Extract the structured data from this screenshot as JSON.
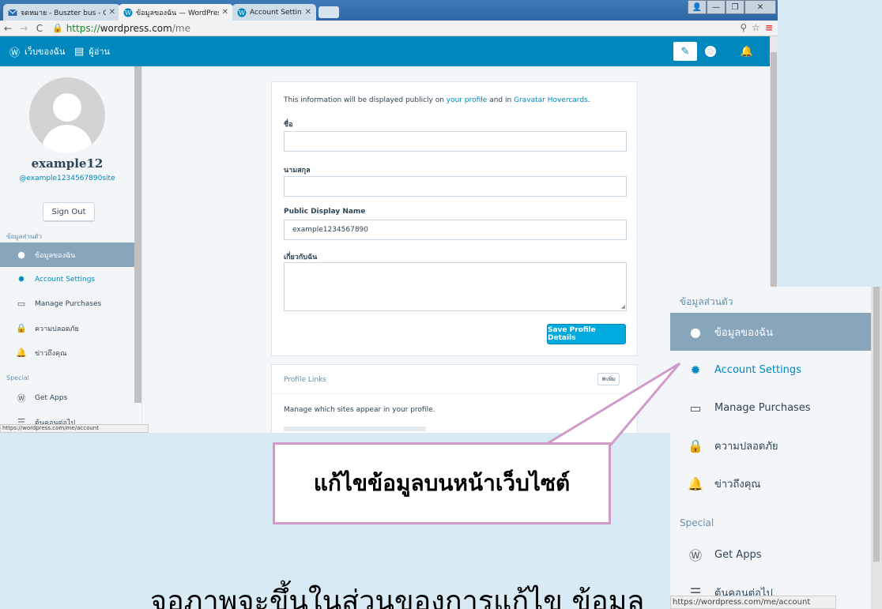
{
  "browser": {
    "tabs": [
      {
        "title": "จดหมาย - Buszter bus - Outlo",
        "icon": "mail-icon"
      },
      {
        "title": "ข้อมูลของฉัน — WordPress.c",
        "icon": "wordpress-icon"
      },
      {
        "title": "Account Settings — WordPre",
        "icon": "wordpress-icon"
      }
    ],
    "url": {
      "scheme": "https://",
      "host": "wordpress.com",
      "path": "/me"
    },
    "status_url": "https://wordpress.com/me/account"
  },
  "masterbar": {
    "my_sites": "เว็บของฉัน",
    "reader": "ผู้อ่าน"
  },
  "profile": {
    "display_name": "example12",
    "username": "@example1234567890site",
    "sign_out": "Sign Out"
  },
  "sidebar": {
    "profile_heading": "ข้อมูลส่วนตัว",
    "items": [
      {
        "label": "ข้อมูลของฉัน",
        "icon": "person-icon"
      },
      {
        "label": "Account Settings",
        "icon": "gear-icon"
      },
      {
        "label": "Manage Purchases",
        "icon": "credit-card-icon"
      },
      {
        "label": "ความปลอดภัย",
        "icon": "lock-icon"
      },
      {
        "label": "ข่าวถึงคุณ",
        "icon": "bell-icon"
      }
    ],
    "special_heading": "Special",
    "special_items": [
      {
        "label": "Get Apps",
        "icon": "wordpress-icon"
      },
      {
        "label": "ต้นคอนต่อไป",
        "icon": "list-icon"
      }
    ]
  },
  "form": {
    "intro_prefix": "This information will be displayed publicly on ",
    "intro_link1": "your profile",
    "intro_middle": " and in ",
    "intro_link2": "Gravatar Hovercards",
    "intro_suffix": ".",
    "first_name_label": "ชื่อ",
    "first_name_value": "",
    "last_name_label": "นามสกุล",
    "last_name_value": "",
    "public_display_name_label": "Public Display Name",
    "public_display_name_value": "example1234567890",
    "about_label": "เกี่ยวกับฉัน",
    "save_button": "Save Profile Details"
  },
  "profile_links": {
    "title": "Profile Links",
    "add_button": "⊕เพิ่ม",
    "description": "Manage which sites appear in your profile."
  },
  "callout": "แก้ไขข้อมูลบนหน้าเว็บไซต์",
  "bottom_caption": "จอภาพจะขึ้นในส่วนของการแก้ไข ข้อมูล",
  "colors": {
    "masterbar": "#0087be",
    "selected_item": "#87a6bc",
    "link": "#0087be",
    "save_button": "#00aadc",
    "callout_border": "#d09bc8"
  }
}
